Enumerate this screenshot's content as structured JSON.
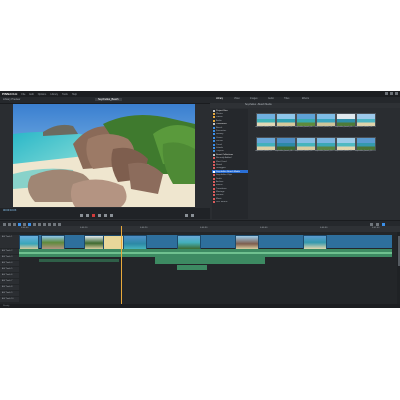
{
  "app": {
    "logo": "PINNACLE",
    "menu": [
      "File",
      "Edit",
      "Options",
      "Library",
      "Tools",
      "Help"
    ],
    "mode_tabs": [
      "Import",
      "Edit",
      "Export"
    ],
    "active_mode": "Edit"
  },
  "player": {
    "panel_label": "Library Preview",
    "title": "Seychelles_Beach",
    "timecode": "00:00:10.03",
    "source_label": "Timeline"
  },
  "browser": {
    "tabs": [
      "Library",
      "Video",
      "Images",
      "Audio",
      "Titles",
      "Effects"
    ],
    "active_tab": "Library",
    "path": "Seychelles  ›  Beach Media",
    "tree": [
      {
        "label": "Project Bins",
        "type": "hdr",
        "color": "#c0c4c8"
      },
      {
        "label": "Photos",
        "type": "item",
        "color": "#e8a93b"
      },
      {
        "label": "Videos",
        "type": "item",
        "color": "#e8a93b"
      },
      {
        "label": "Audio",
        "type": "item",
        "color": "#e8a93b"
      },
      {
        "label": "Collections",
        "type": "hdr",
        "color": "#c0c4c8"
      },
      {
        "label": "Beach",
        "type": "item",
        "color": "#3b8fe8"
      },
      {
        "label": "Favourites",
        "type": "item",
        "color": "#3b8fe8"
      },
      {
        "label": "Holiday",
        "type": "item",
        "color": "#3b8fe8"
      },
      {
        "label": "Ocean",
        "type": "item",
        "color": "#3b8fe8"
      },
      {
        "label": "Sunset",
        "type": "item",
        "color": "#3b8fe8"
      },
      {
        "label": "Travel",
        "type": "item",
        "color": "#3b8fe8"
      },
      {
        "label": "Islands",
        "type": "item",
        "color": "#3b8fe8"
      },
      {
        "label": "Tropical",
        "type": "item",
        "color": "#3b8fe8"
      },
      {
        "label": "Smart Collections",
        "type": "hdr",
        "color": "#c0c4c8"
      },
      {
        "label": "Recently Added",
        "type": "item",
        "color": "#d95b5b"
      },
      {
        "label": "Most Used",
        "type": "item",
        "color": "#d95b5b"
      },
      {
        "label": "Rated",
        "type": "item",
        "color": "#d95b5b"
      },
      {
        "label": "Untagged",
        "type": "item",
        "color": "#d95b5b"
      },
      {
        "label": "Seychelles Beach Media",
        "type": "sel",
        "color": "#ffffff"
      },
      {
        "label": "Seychelles Clips",
        "type": "item",
        "color": "#d95b5b"
      },
      {
        "label": "Drafts",
        "type": "item",
        "color": "#d95b5b"
      },
      {
        "label": "Archive",
        "type": "item",
        "color": "#d95b5b"
      },
      {
        "label": "Menus",
        "type": "item",
        "color": "#d95b5b"
      },
      {
        "label": "Transitions",
        "type": "item",
        "color": "#d95b5b"
      },
      {
        "label": "Montage",
        "type": "item",
        "color": "#d95b5b"
      },
      {
        "label": "Sounds",
        "type": "item",
        "color": "#d95b5b"
      },
      {
        "label": "Music",
        "type": "item",
        "color": "#d95b5b"
      },
      {
        "label": "Disc Menus",
        "type": "item",
        "color": "#d95b5b"
      }
    ],
    "thumbnails": [
      {
        "name": "seychelles_beach_01",
        "sky": "#6fb0df",
        "sea": "#3fb3b8",
        "land": "#e2d7b5"
      },
      {
        "name": "seychelles_beach_02",
        "sky": "#8ec6ea",
        "sea": "#2fa2b3",
        "land": "#d7c99b"
      },
      {
        "name": "seychelles_beach_03",
        "sky": "#5ea2d6",
        "sea": "#37aab0",
        "land": "#5f8a3c"
      },
      {
        "name": "seychelles_beach_04",
        "sky": "#7fbde6",
        "sea": "#3aa6c0",
        "land": "#cfc59a"
      },
      {
        "name": "seychelles_beach_05",
        "sky": "#dfe8ee",
        "sea": "#2f8fa8",
        "land": "#4f7a38"
      },
      {
        "name": "seychelles_beach_06",
        "sky": "#9cc9ea",
        "sea": "#4db5c3",
        "land": "#e0d3aa"
      },
      {
        "name": "seychelles_beach_07",
        "sky": "#6aa8d9",
        "sea": "#43b0bb",
        "land": "#ddd0a4"
      },
      {
        "name": "seychelles_beach_08",
        "sky": "#4f8fc6",
        "sea": "#2c89a6",
        "land": "#3e6a30"
      },
      {
        "name": "seychelles_beach_09",
        "sky": "#86bde4",
        "sea": "#46b4bc",
        "land": "#d9cc9f"
      },
      {
        "name": "seychelles_beach_10",
        "sky": "#7ab4df",
        "sea": "#3ba8b5",
        "land": "#5a8642"
      },
      {
        "name": "seychelles_beach_11",
        "sky": "#9ccbe9",
        "sea": "#50b9c2",
        "land": "#e3d6ad"
      },
      {
        "name": "seychelles_beach_12",
        "sky": "#5b9bd0",
        "sea": "#3499ad",
        "land": "#4b7535"
      }
    ]
  },
  "timeline": {
    "title": "Timeline",
    "ruler_labels": [
      "0:00:00",
      "0:00:10",
      "0:00:20",
      "0:00:30",
      "0:00:40",
      "0:00:50",
      "0:01:00"
    ],
    "tracks": [
      "A/V Track 1",
      "A/V Track 2",
      "A/V Track 3",
      "A/V Track 4",
      "A/V Track 5",
      "A/V Track 6",
      "A/V Track 7",
      "A/V Track 8",
      "A/V Track 9",
      "A/V Track 10"
    ],
    "status": "Ready"
  },
  "colors": {
    "accent": "#2a6fd6",
    "video_clip": "#2e6f9d",
    "audio_clip": "#3d8a62",
    "playhead": "#e8a93b"
  }
}
